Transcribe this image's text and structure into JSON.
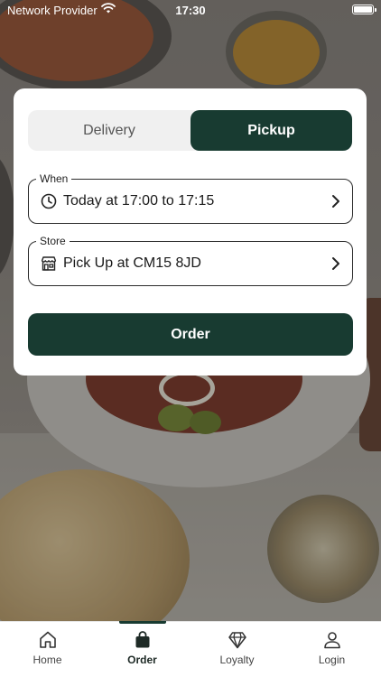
{
  "status_bar": {
    "carrier": "Network Provider",
    "time": "17:30"
  },
  "order_card": {
    "segments": {
      "delivery_label": "Delivery",
      "pickup_label": "Pickup",
      "selected": "pickup"
    },
    "when": {
      "legend": "When",
      "value": "Today at 17:00 to 17:15",
      "icon": "clock-icon"
    },
    "store": {
      "legend": "Store",
      "value": "Pick Up at CM15 8JD",
      "icon": "store-icon"
    },
    "order_button_label": "Order"
  },
  "tab_bar": {
    "active": "order",
    "items": [
      {
        "label": "Home",
        "icon": "home-icon"
      },
      {
        "label": "Order",
        "icon": "shopping-bag-icon"
      },
      {
        "label": "Loyalty",
        "icon": "diamond-icon"
      },
      {
        "label": "Login",
        "icon": "user-icon"
      }
    ]
  },
  "colors": {
    "primary": "#183b31",
    "segment_background": "#f0f0f0",
    "card_background": "#ffffff"
  }
}
